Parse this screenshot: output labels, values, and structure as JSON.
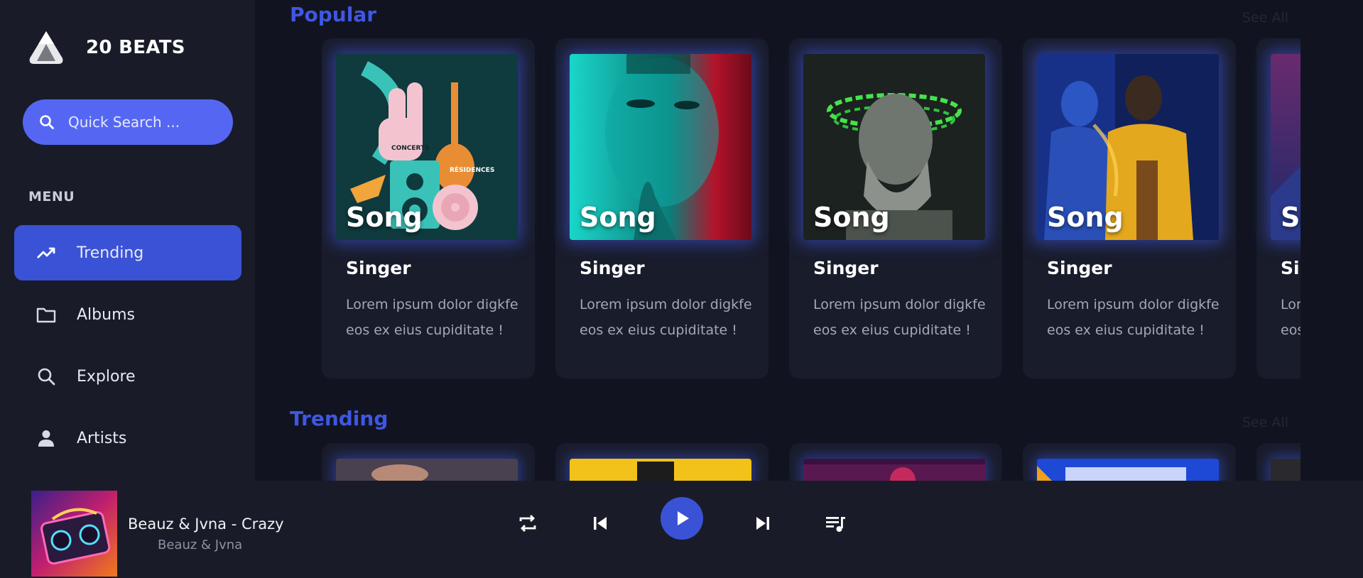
{
  "brand": {
    "name": "20 BEATS",
    "icon": "mountain-logo-icon"
  },
  "search": {
    "placeholder": "Quick Search ...",
    "icon": "search-icon"
  },
  "menu": {
    "heading": "MENU",
    "items": [
      {
        "label": "Trending",
        "icon": "trending-up-icon",
        "active": true
      },
      {
        "label": "Albums",
        "icon": "folder-icon",
        "active": false
      },
      {
        "label": "Explore",
        "icon": "search-icon",
        "active": false
      },
      {
        "label": "Artists",
        "icon": "person-icon",
        "active": false
      }
    ]
  },
  "sections": {
    "popular": {
      "title": "Popular",
      "see_all": "See All",
      "cards": [
        {
          "song": "Song",
          "singer": "Singer",
          "description": "Lorem ipsum dolor digkfe eos ex eius cupiditate !"
        },
        {
          "song": "Song",
          "singer": "Singer",
          "description": "Lorem ipsum dolor digkfe eos ex eius cupiditate !"
        },
        {
          "song": "Song",
          "singer": "Singer",
          "description": "Lorem ipsum dolor digkfe eos ex eius cupiditate !"
        },
        {
          "song": "Song",
          "singer": "Singer",
          "description": "Lorem ipsum dolor digkfe eos ex eius cupiditate !"
        },
        {
          "song": "Song",
          "singer": "Singer",
          "description": "Lorem ipsum dolor digkfe eos ex eius cupiditate !"
        }
      ]
    },
    "trending": {
      "title": "Trending",
      "see_all": "See All"
    }
  },
  "player": {
    "title": "Beauz & Jvna - Crazy",
    "artist": "Beauz & Jvna",
    "controls": [
      "repeat-icon",
      "skip-previous-icon",
      "play-icon",
      "skip-next-icon",
      "queue-music-icon"
    ]
  },
  "colors": {
    "accent": "#3a52d6",
    "search_bg": "#5567f2",
    "section_title": "#3f57e2",
    "background": "#111420",
    "panel": "#191c28"
  }
}
